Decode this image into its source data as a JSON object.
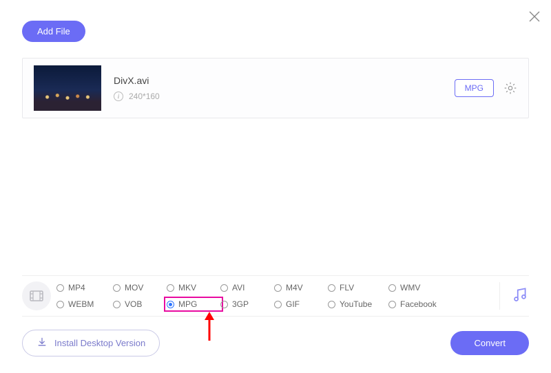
{
  "toolbar": {
    "add_file_label": "Add File"
  },
  "file": {
    "name": "DivX.avi",
    "resolution": "240*160",
    "selected_format": "MPG"
  },
  "formats": {
    "row1": [
      {
        "id": "mp4",
        "label": "MP4",
        "checked": false
      },
      {
        "id": "mov",
        "label": "MOV",
        "checked": false
      },
      {
        "id": "mkv",
        "label": "MKV",
        "checked": false
      },
      {
        "id": "avi",
        "label": "AVI",
        "checked": false
      },
      {
        "id": "m4v",
        "label": "M4V",
        "checked": false
      },
      {
        "id": "flv",
        "label": "FLV",
        "checked": false
      },
      {
        "id": "wmv",
        "label": "WMV",
        "checked": false
      }
    ],
    "row2": [
      {
        "id": "webm",
        "label": "WEBM",
        "checked": false
      },
      {
        "id": "vob",
        "label": "VOB",
        "checked": false
      },
      {
        "id": "mpg",
        "label": "MPG",
        "checked": true,
        "highlight": true
      },
      {
        "id": "3gp",
        "label": "3GP",
        "checked": false
      },
      {
        "id": "gif",
        "label": "GIF",
        "checked": false
      },
      {
        "id": "youtube",
        "label": "YouTube",
        "checked": false
      },
      {
        "id": "facebook",
        "label": "Facebook",
        "checked": false
      }
    ]
  },
  "bottom": {
    "install_label": "Install Desktop Version",
    "convert_label": "Convert"
  },
  "colors": {
    "accent": "#6b6cf5",
    "highlight": "#e80aa0"
  }
}
